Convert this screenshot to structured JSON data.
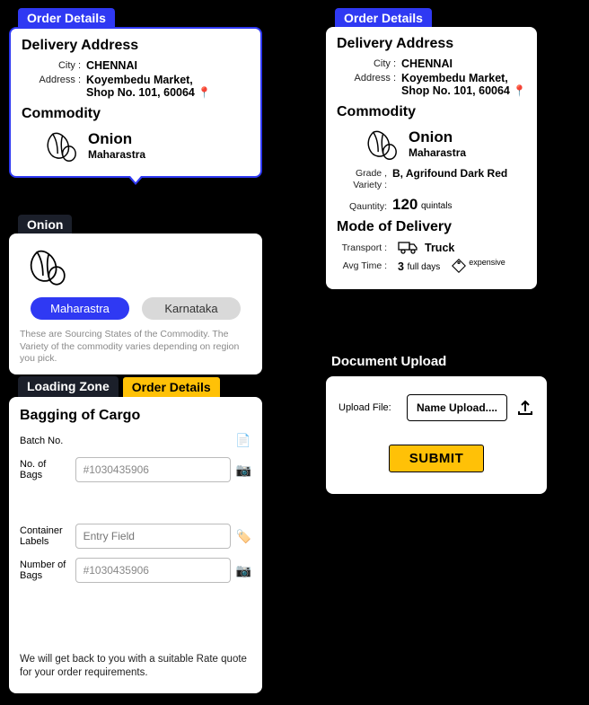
{
  "card1": {
    "tag": "Order Details",
    "delivery_h": "Delivery Address",
    "city_lbl": "City :",
    "city": "CHENNAI",
    "addr_lbl": "Address :",
    "addr_l1": "Koyembedu Market,",
    "addr_l2": "Shop No. 101, 60064",
    "commodity_h": "Commodity",
    "comm_name": "Onion",
    "comm_sub": "Maharastra"
  },
  "card2": {
    "tag": "Onion",
    "chip1": "Maharastra",
    "chip2": "Karnataka",
    "hint": "These are Sourcing States of the Commodity. The Variety of the commodity varies depending on region you pick."
  },
  "card3": {
    "tag1": "Loading Zone",
    "tag2": "Order Details",
    "h": "Bagging of Cargo",
    "f1_lbl": "Batch No.",
    "f2_lbl": "No. of Bags",
    "f2_val": "#1030435906",
    "f3_lbl": "Container Labels",
    "f3_val": "Entry Field",
    "f4_lbl": "Number of Bags",
    "f4_val": "#1030435906",
    "footer": "We will get back to you with a suitable Rate quote for your order requirements."
  },
  "card4": {
    "tag": "Order Details",
    "delivery_h": "Delivery Address",
    "city_lbl": "City :",
    "city": "CHENNAI",
    "addr_lbl": "Address :",
    "addr_l1": "Koyembedu Market,",
    "addr_l2": "Shop No. 101, 60064",
    "commodity_h": "Commodity",
    "comm_name": "Onion",
    "comm_sub": "Maharastra",
    "grade_lbl": "Grade , Variety :",
    "grade_val": "B, Agrifound Dark Red",
    "qty_lbl": "Qauntity:",
    "qty_val": "120",
    "qty_unit": "quintals",
    "mode_h": "Mode of Delivery",
    "transport_lbl": "Transport :",
    "transport_val": "Truck",
    "avgtime_lbl": "Avg Time :",
    "avgtime_val": "3",
    "avgtime_unit": "full  days",
    "price_note": "expensive"
  },
  "card5": {
    "title": "Document Upload",
    "lbl": "Upload File:",
    "placeholder": "Name Upload....",
    "submit": "SUBMIT"
  }
}
